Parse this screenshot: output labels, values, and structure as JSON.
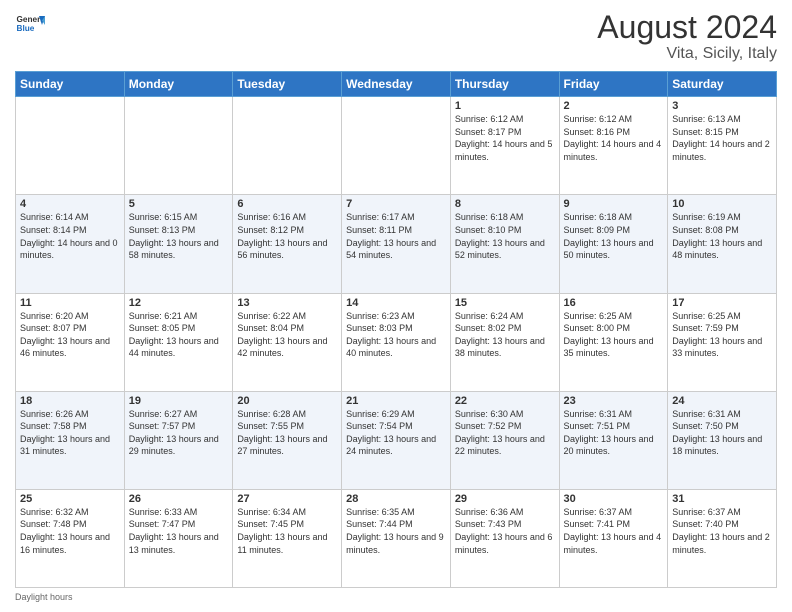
{
  "header": {
    "logo_general": "General",
    "logo_blue": "Blue",
    "month_title": "August 2024",
    "location": "Vita, Sicily, Italy"
  },
  "days_of_week": [
    "Sunday",
    "Monday",
    "Tuesday",
    "Wednesday",
    "Thursday",
    "Friday",
    "Saturday"
  ],
  "weeks": [
    [
      {
        "day": "",
        "sunrise": "",
        "sunset": "",
        "daylight": ""
      },
      {
        "day": "",
        "sunrise": "",
        "sunset": "",
        "daylight": ""
      },
      {
        "day": "",
        "sunrise": "",
        "sunset": "",
        "daylight": ""
      },
      {
        "day": "",
        "sunrise": "",
        "sunset": "",
        "daylight": ""
      },
      {
        "day": "1",
        "sunrise": "6:12 AM",
        "sunset": "8:17 PM",
        "daylight": "14 hours and 5 minutes."
      },
      {
        "day": "2",
        "sunrise": "6:12 AM",
        "sunset": "8:16 PM",
        "daylight": "14 hours and 4 minutes."
      },
      {
        "day": "3",
        "sunrise": "6:13 AM",
        "sunset": "8:15 PM",
        "daylight": "14 hours and 2 minutes."
      }
    ],
    [
      {
        "day": "4",
        "sunrise": "6:14 AM",
        "sunset": "8:14 PM",
        "daylight": "14 hours and 0 minutes."
      },
      {
        "day": "5",
        "sunrise": "6:15 AM",
        "sunset": "8:13 PM",
        "daylight": "13 hours and 58 minutes."
      },
      {
        "day": "6",
        "sunrise": "6:16 AM",
        "sunset": "8:12 PM",
        "daylight": "13 hours and 56 minutes."
      },
      {
        "day": "7",
        "sunrise": "6:17 AM",
        "sunset": "8:11 PM",
        "daylight": "13 hours and 54 minutes."
      },
      {
        "day": "8",
        "sunrise": "6:18 AM",
        "sunset": "8:10 PM",
        "daylight": "13 hours and 52 minutes."
      },
      {
        "day": "9",
        "sunrise": "6:18 AM",
        "sunset": "8:09 PM",
        "daylight": "13 hours and 50 minutes."
      },
      {
        "day": "10",
        "sunrise": "6:19 AM",
        "sunset": "8:08 PM",
        "daylight": "13 hours and 48 minutes."
      }
    ],
    [
      {
        "day": "11",
        "sunrise": "6:20 AM",
        "sunset": "8:07 PM",
        "daylight": "13 hours and 46 minutes."
      },
      {
        "day": "12",
        "sunrise": "6:21 AM",
        "sunset": "8:05 PM",
        "daylight": "13 hours and 44 minutes."
      },
      {
        "day": "13",
        "sunrise": "6:22 AM",
        "sunset": "8:04 PM",
        "daylight": "13 hours and 42 minutes."
      },
      {
        "day": "14",
        "sunrise": "6:23 AM",
        "sunset": "8:03 PM",
        "daylight": "13 hours and 40 minutes."
      },
      {
        "day": "15",
        "sunrise": "6:24 AM",
        "sunset": "8:02 PM",
        "daylight": "13 hours and 38 minutes."
      },
      {
        "day": "16",
        "sunrise": "6:25 AM",
        "sunset": "8:00 PM",
        "daylight": "13 hours and 35 minutes."
      },
      {
        "day": "17",
        "sunrise": "6:25 AM",
        "sunset": "7:59 PM",
        "daylight": "13 hours and 33 minutes."
      }
    ],
    [
      {
        "day": "18",
        "sunrise": "6:26 AM",
        "sunset": "7:58 PM",
        "daylight": "13 hours and 31 minutes."
      },
      {
        "day": "19",
        "sunrise": "6:27 AM",
        "sunset": "7:57 PM",
        "daylight": "13 hours and 29 minutes."
      },
      {
        "day": "20",
        "sunrise": "6:28 AM",
        "sunset": "7:55 PM",
        "daylight": "13 hours and 27 minutes."
      },
      {
        "day": "21",
        "sunrise": "6:29 AM",
        "sunset": "7:54 PM",
        "daylight": "13 hours and 24 minutes."
      },
      {
        "day": "22",
        "sunrise": "6:30 AM",
        "sunset": "7:52 PM",
        "daylight": "13 hours and 22 minutes."
      },
      {
        "day": "23",
        "sunrise": "6:31 AM",
        "sunset": "7:51 PM",
        "daylight": "13 hours and 20 minutes."
      },
      {
        "day": "24",
        "sunrise": "6:31 AM",
        "sunset": "7:50 PM",
        "daylight": "13 hours and 18 minutes."
      }
    ],
    [
      {
        "day": "25",
        "sunrise": "6:32 AM",
        "sunset": "7:48 PM",
        "daylight": "13 hours and 16 minutes."
      },
      {
        "day": "26",
        "sunrise": "6:33 AM",
        "sunset": "7:47 PM",
        "daylight": "13 hours and 13 minutes."
      },
      {
        "day": "27",
        "sunrise": "6:34 AM",
        "sunset": "7:45 PM",
        "daylight": "13 hours and 11 minutes."
      },
      {
        "day": "28",
        "sunrise": "6:35 AM",
        "sunset": "7:44 PM",
        "daylight": "13 hours and 9 minutes."
      },
      {
        "day": "29",
        "sunrise": "6:36 AM",
        "sunset": "7:43 PM",
        "daylight": "13 hours and 6 minutes."
      },
      {
        "day": "30",
        "sunrise": "6:37 AM",
        "sunset": "7:41 PM",
        "daylight": "13 hours and 4 minutes."
      },
      {
        "day": "31",
        "sunrise": "6:37 AM",
        "sunset": "7:40 PM",
        "daylight": "13 hours and 2 minutes."
      }
    ]
  ],
  "footer": {
    "daylight_label": "Daylight hours"
  }
}
